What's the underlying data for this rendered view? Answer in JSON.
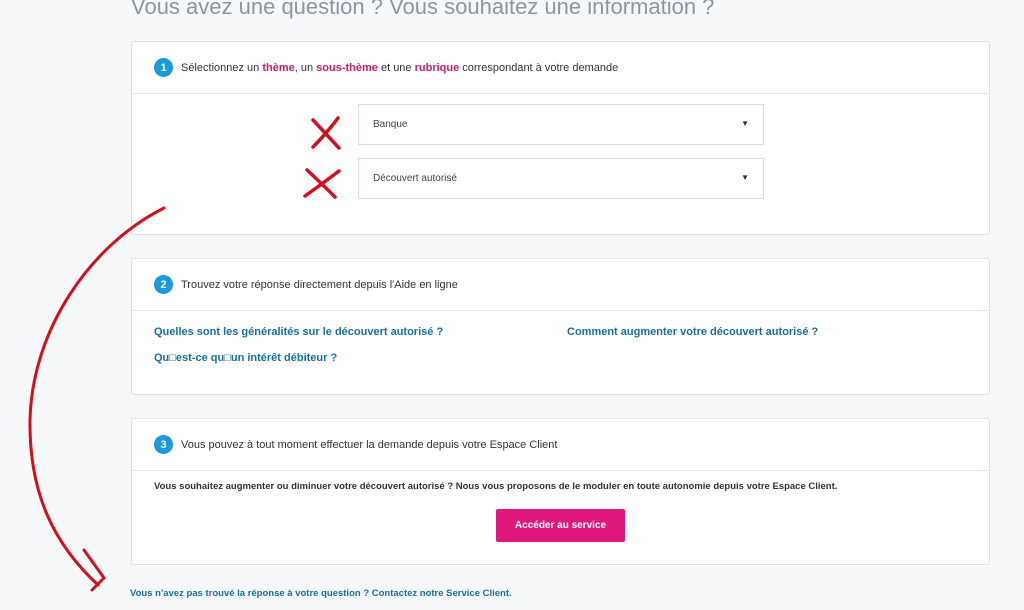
{
  "page": {
    "title": "Vous avez une question ? Vous souhaitez une information ?"
  },
  "step1": {
    "number": "1",
    "title": {
      "t1": "Sélectionnez un ",
      "h1": "thème",
      "t2": ", un ",
      "h2": "sous-thème",
      "t3": " et une ",
      "h3": "rubrique",
      "t4": " correspondant à votre demande"
    },
    "theme_select": {
      "value": "Banque"
    },
    "subtheme_select": {
      "value": "Découvert autorisé"
    }
  },
  "step2": {
    "number": "2",
    "title": "Trouvez votre réponse directement depuis l'Aide en ligne",
    "links": [
      "Quelles sont les généralités sur le découvert autorisé ?",
      "Comment augmenter votre découvert autorisé ?",
      "Qu□est-ce qu□un intérêt débiteur ?"
    ]
  },
  "step3": {
    "number": "3",
    "title": "Vous pouvez à tout moment effectuer la demande depuis votre Espace Client",
    "description": "Vous souhaitez augmenter ou diminuer votre découvert autorisé ? Nous vous proposons de le moduler en toute autonomie depuis votre Espace Client.",
    "button_label": "Accéder au service"
  },
  "footer": {
    "contact_text": "Vous n'avez pas trouvé la réponse à votre question ? Contactez notre Service Client."
  },
  "icons": {
    "caret": "caret-down-icon",
    "cross": "red-cross-annotation",
    "arrow": "red-curved-arrow-annotation"
  },
  "colors": {
    "accent_blue": "#1a9ad6",
    "link_blue": "#1a6e9e",
    "highlight_magenta": "#c41e6f",
    "button_pink": "#e0177d",
    "annotation_red": "#d0101c"
  }
}
